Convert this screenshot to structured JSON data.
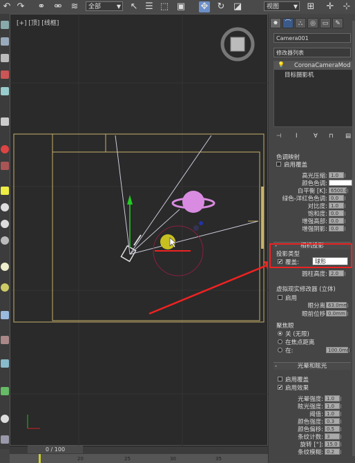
{
  "toolbar": {
    "selection_filter": "全部",
    "reference_coord": "视图",
    "icons": [
      "undo-icon",
      "redo-icon",
      "link-icon",
      "unlink-icon",
      "bind-icon",
      "select-filter-icon",
      "select-icon",
      "select-by-name-icon",
      "rect-select-icon",
      "window-crossing-icon",
      "move-icon",
      "rotate-icon",
      "scale-icon",
      "pivot-icon",
      "snap-icon",
      "align-icon",
      "pan-icon"
    ]
  },
  "viewport": {
    "label": "[+] [顶] [线框]",
    "accent_colors": {
      "safe_frame": "#c8b26a",
      "gizmo_pink": "#d88be0",
      "camera_target": "#c8c020",
      "grid": "#3a3a3a"
    }
  },
  "timeline": {
    "frame_display": "0 / 100",
    "ticks": [
      "20",
      "25",
      "30",
      "35"
    ]
  },
  "panel": {
    "tabs": [
      "create-icon",
      "modify-icon",
      "hierarchy-icon",
      "motion-icon",
      "display-icon",
      "utilities-icon"
    ],
    "object_name": "Camera001",
    "modifier_list": "修改器列表",
    "stack": {
      "modifier": "CoronaCameraMod",
      "base": "目标摄影机"
    },
    "stack_buttons": [
      "pin-icon",
      "show-end-icon",
      "make-unique-icon",
      "remove-icon",
      "configure-icon"
    ],
    "tone_mapping": {
      "title_partial": "色调映射",
      "override": "启用覆盖",
      "rows": [
        {
          "label": "高光压缩:",
          "value": "1.0"
        },
        {
          "label": "颜色色调:",
          "value": ""
        },
        {
          "label": "白平衡 [K]:",
          "value": "6500.0"
        },
        {
          "label": "绿色-洋红色色调:",
          "value": "0.0"
        },
        {
          "label": "对比度:",
          "value": "1.0"
        },
        {
          "label": "饱和度:",
          "value": "0.0"
        },
        {
          "label": "增强高部:",
          "value": "0.0"
        },
        {
          "label": "增强阴影:",
          "value": "0.0"
        }
      ]
    },
    "projection": {
      "title": "相机投影",
      "type_label": "投影类型",
      "override_label": "覆盖:",
      "override_value": "球形",
      "cylinder_label": "圆柱高度:",
      "cylinder_value": "2.0"
    },
    "vr": {
      "title": "虚拟现实修改器 (立体)",
      "enable": "启用",
      "rows": [
        {
          "label": "眼分离:",
          "value": "63.0mm"
        },
        {
          "label": "眼前位移:",
          "value": "0.0mm"
        }
      ]
    },
    "focus": {
      "title": "聚焦眼",
      "options": [
        "关 (无限)",
        "在焦点距离",
        "在:"
      ],
      "at_value": "100.0mm"
    },
    "bloom": {
      "title": "光晕和眩光",
      "override": "启用覆盖",
      "enable": "启用效果",
      "rows": [
        {
          "label": "光晕强度:",
          "value": "1.0"
        },
        {
          "label": "眩光强度:",
          "value": "1.0"
        },
        {
          "label": "阈值:",
          "value": "1.0"
        },
        {
          "label": "颜色强度:",
          "value": "0.3"
        },
        {
          "label": "颜色偏移:",
          "value": "0.5"
        },
        {
          "label": "条纹计数:",
          "value": "3"
        },
        {
          "label": "旋转 [°]:",
          "value": "15.0"
        },
        {
          "label": "条纹模糊:",
          "value": "0.2"
        }
      ]
    }
  }
}
